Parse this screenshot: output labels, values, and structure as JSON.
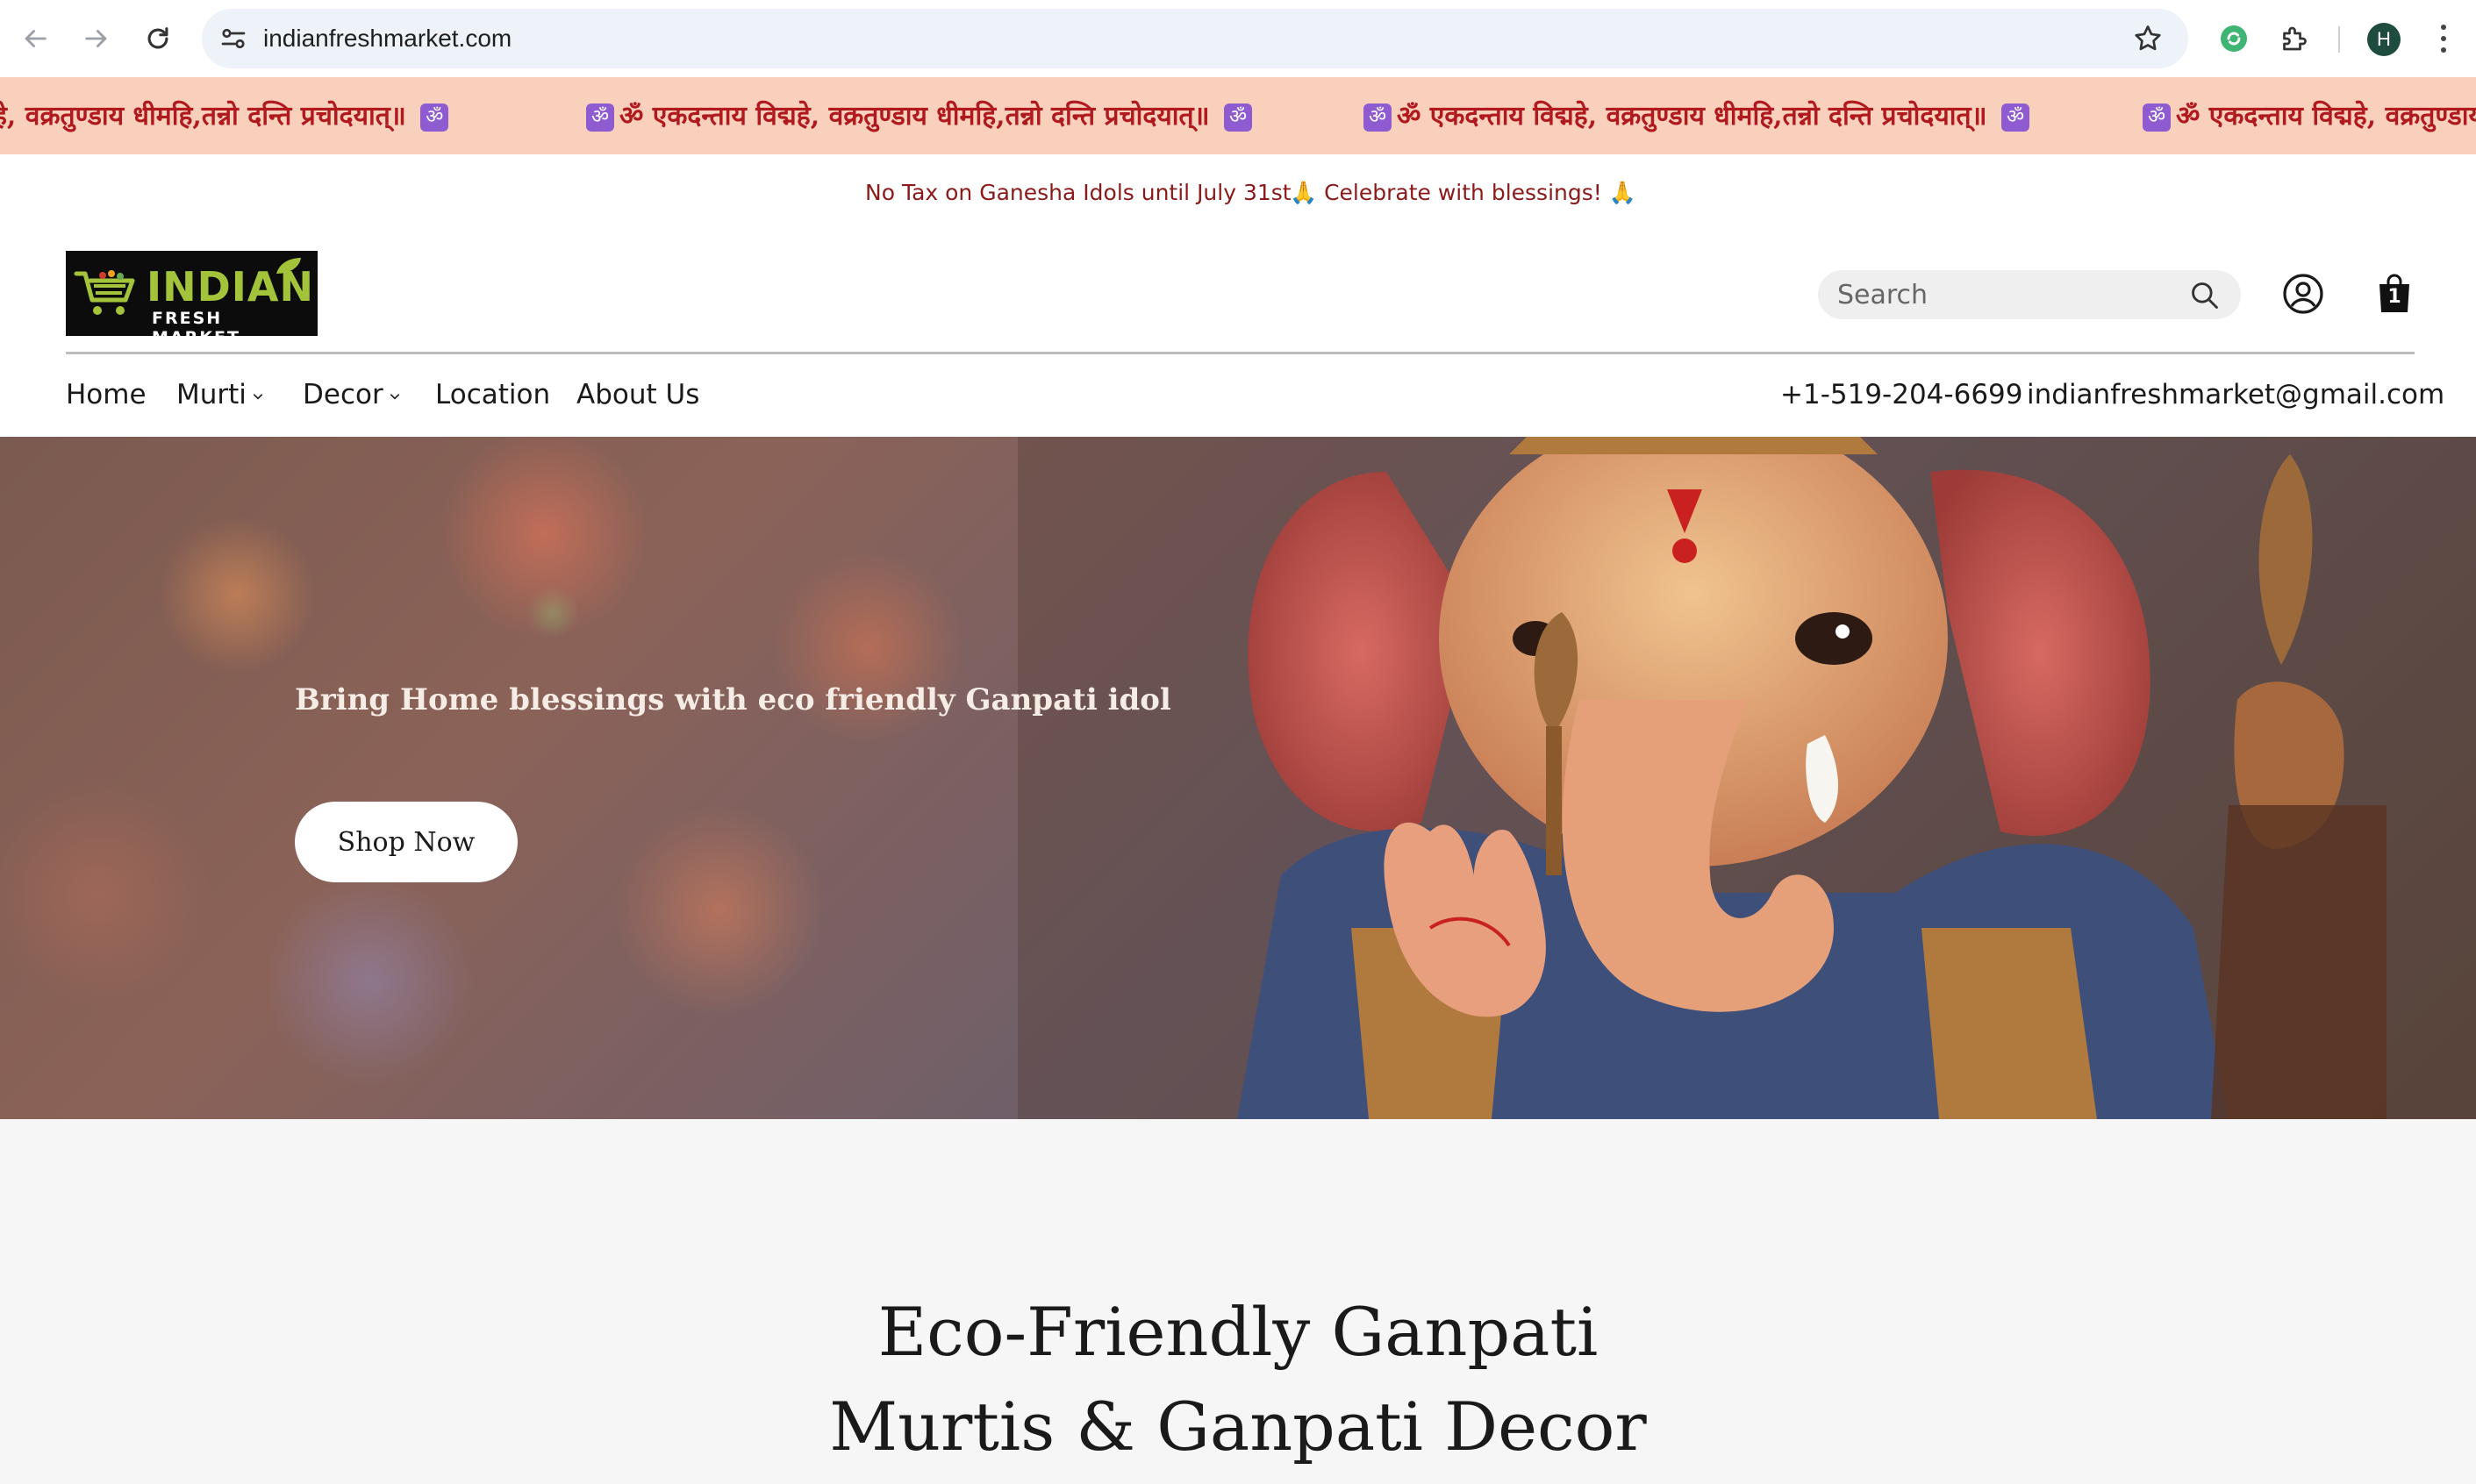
{
  "browser": {
    "url": "indianfreshmarket.com",
    "profile_initial": "H"
  },
  "marquee": {
    "text": "ॐ एकदन्ताय विद्महे, वक्रतुण्डाय धीमहि,तन्नो दन्ति प्रचोदयात्॥",
    "leading_fragment": "द्महे, वक्रतुण्डाय धीमहि,तन्नो दन्ति प्रचोदयात्॥",
    "trailing_fragment": "ॐ एकदन्ताय विद्महे, वक्रतुण्डाय",
    "badge": "ॐ",
    "background_color": "#f8d0bb",
    "text_color": "#b0191e"
  },
  "announcement": {
    "left": "No Tax on Ganesha Idols until July 31st",
    "right": "🙏 Celebrate with blessings! 🙏"
  },
  "header": {
    "logo_main": "INDIAN",
    "logo_sub": "FRESH MARKET",
    "search_placeholder": "Search",
    "cart_count": "1"
  },
  "nav": {
    "items": [
      {
        "label": "Home"
      },
      {
        "label": "Murti"
      },
      {
        "label": "Decor"
      },
      {
        "label": "Location"
      },
      {
        "label": "About Us"
      }
    ],
    "phone": "+1-519-204-6699",
    "email": "indianfreshmarket@gmail.com"
  },
  "hero": {
    "heading": "Bring Home blessings with eco friendly Ganpati idol",
    "button_label": "Shop Now"
  },
  "section": {
    "title_line1": "Eco-Friendly Ganpati",
    "title_line2": "Murtis & Ganpati Decor"
  }
}
